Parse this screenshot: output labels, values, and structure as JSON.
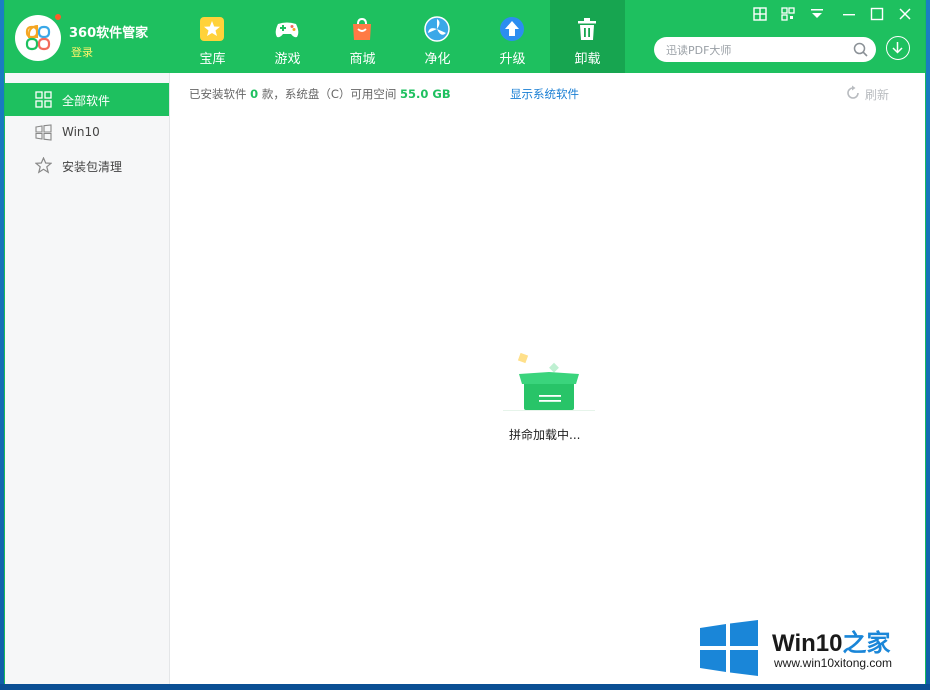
{
  "app": {
    "title": "360软件管家",
    "login": "登录"
  },
  "nav": [
    {
      "label": "宝库",
      "icon": "star-icon"
    },
    {
      "label": "游戏",
      "icon": "gamepad-icon"
    },
    {
      "label": "商城",
      "icon": "shopping-bag-icon"
    },
    {
      "label": "净化",
      "icon": "fan-icon"
    },
    {
      "label": "升级",
      "icon": "upgrade-arrow-icon"
    },
    {
      "label": "卸载",
      "icon": "trash-icon",
      "active": true
    }
  ],
  "window_controls": [
    "grid-icon",
    "qr-icon",
    "dropdown-icon",
    "minimize-icon",
    "maximize-icon",
    "close-icon"
  ],
  "search": {
    "placeholder": "迅读PDF大师"
  },
  "sidebar": {
    "items": [
      {
        "label": "全部软件",
        "icon": "grid-icon",
        "active": true
      },
      {
        "label": "Win10",
        "icon": "windows-icon"
      },
      {
        "label": "安装包清理",
        "icon": "star-outline-icon"
      }
    ]
  },
  "info": {
    "prefix": "已安装软件",
    "count": "0",
    "middle": "款，系统盘（C）可用空间",
    "free_space": "55.0 GB"
  },
  "show_system_software": "显示系统软件",
  "refresh_label": "刷新",
  "loading_text": "拼命加载中...",
  "watermark": {
    "title_main": "Win10",
    "title_accent": "之家",
    "url": "www.win10xitong.com"
  },
  "colors": {
    "brand_green": "#1ec05f",
    "active_nav": "#17a550",
    "link_blue": "#1a7fd4",
    "login_yellow": "#fff46b"
  }
}
